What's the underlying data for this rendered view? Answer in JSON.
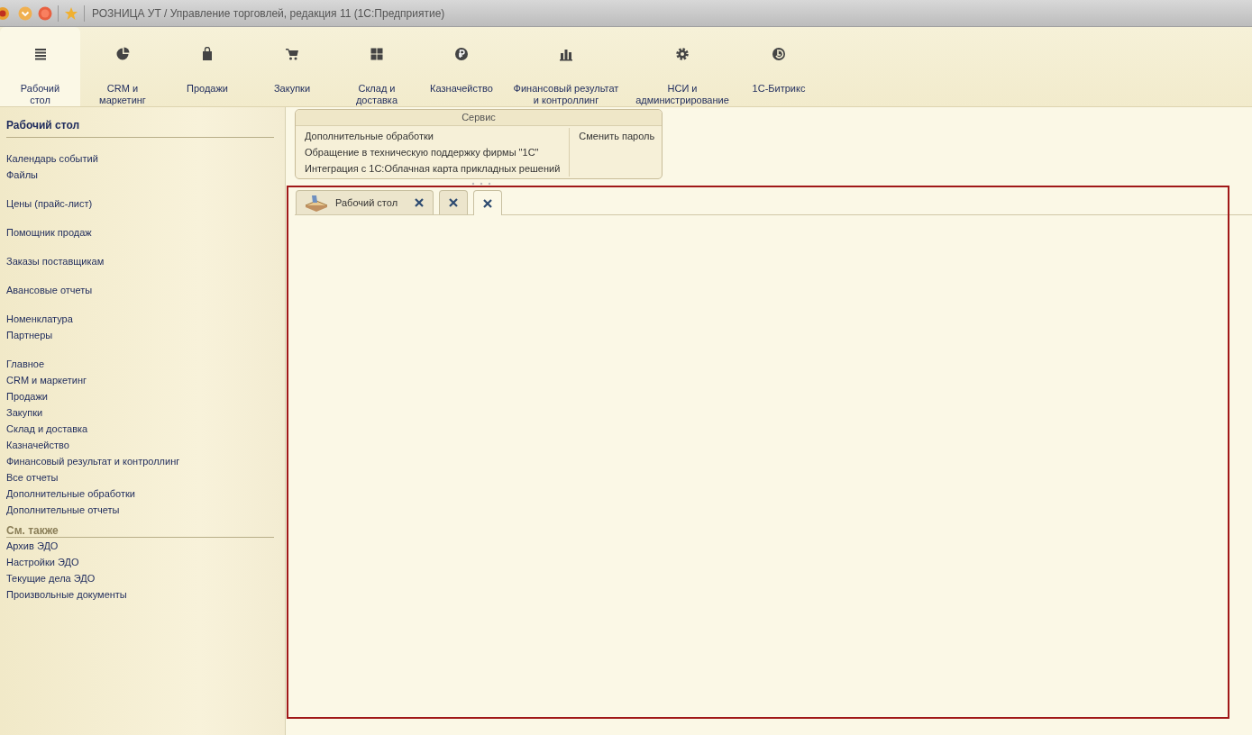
{
  "window": {
    "title": "РОЗНИЦА УТ / Управление торговлей, редакция 11  (1С:Предприятие)"
  },
  "sections": [
    {
      "label": "Рабочий\nстол",
      "selected": true
    },
    {
      "label": "CRM и\nмаркетинг",
      "selected": false
    },
    {
      "label": "Продажи",
      "selected": false
    },
    {
      "label": "Закупки",
      "selected": false
    },
    {
      "label": "Склад и\nдоставка",
      "selected": false
    },
    {
      "label": "Казначейство",
      "selected": false
    },
    {
      "label": "Финансовый результат\nи контроллинг",
      "selected": false
    },
    {
      "label": "НСИ и\nадминистрирование",
      "selected": false
    },
    {
      "label": "1С-Битрикс",
      "selected": false
    }
  ],
  "sidebar": {
    "title": "Рабочий стол",
    "groups": [
      [
        "Календарь событий",
        "Файлы"
      ],
      [
        "Цены (прайс-лист)"
      ],
      [
        "Помощник продаж"
      ],
      [
        "Заказы поставщикам"
      ],
      [
        "Авансовые отчеты"
      ],
      [
        "Номенклатура",
        "Партнеры"
      ],
      [
        "Главное",
        "CRM и маркетинг",
        "Продажи",
        "Закупки",
        "Склад и доставка",
        "Казначейство",
        "Финансовый результат и контроллинг",
        "Все отчеты",
        "Дополнительные обработки",
        "Дополнительные отчеты"
      ]
    ],
    "see_also": {
      "title": "См. также",
      "items": [
        "Архив ЭДО",
        "Настройки ЭДО",
        "Текущие дела ЭДО",
        "Произвольные документы"
      ]
    }
  },
  "service_panel": {
    "title": "Сервис",
    "left_items": [
      "Дополнительные обработки",
      "Обращение в техническую поддержку фирмы \"1С\"",
      "Интеграция с 1С:Облачная карта прикладных решений"
    ],
    "right_items": [
      "Сменить пароль"
    ]
  },
  "tabs": [
    {
      "label": "Рабочий стол",
      "selected": false
    },
    {
      "selected": false
    },
    {
      "selected": true
    }
  ]
}
